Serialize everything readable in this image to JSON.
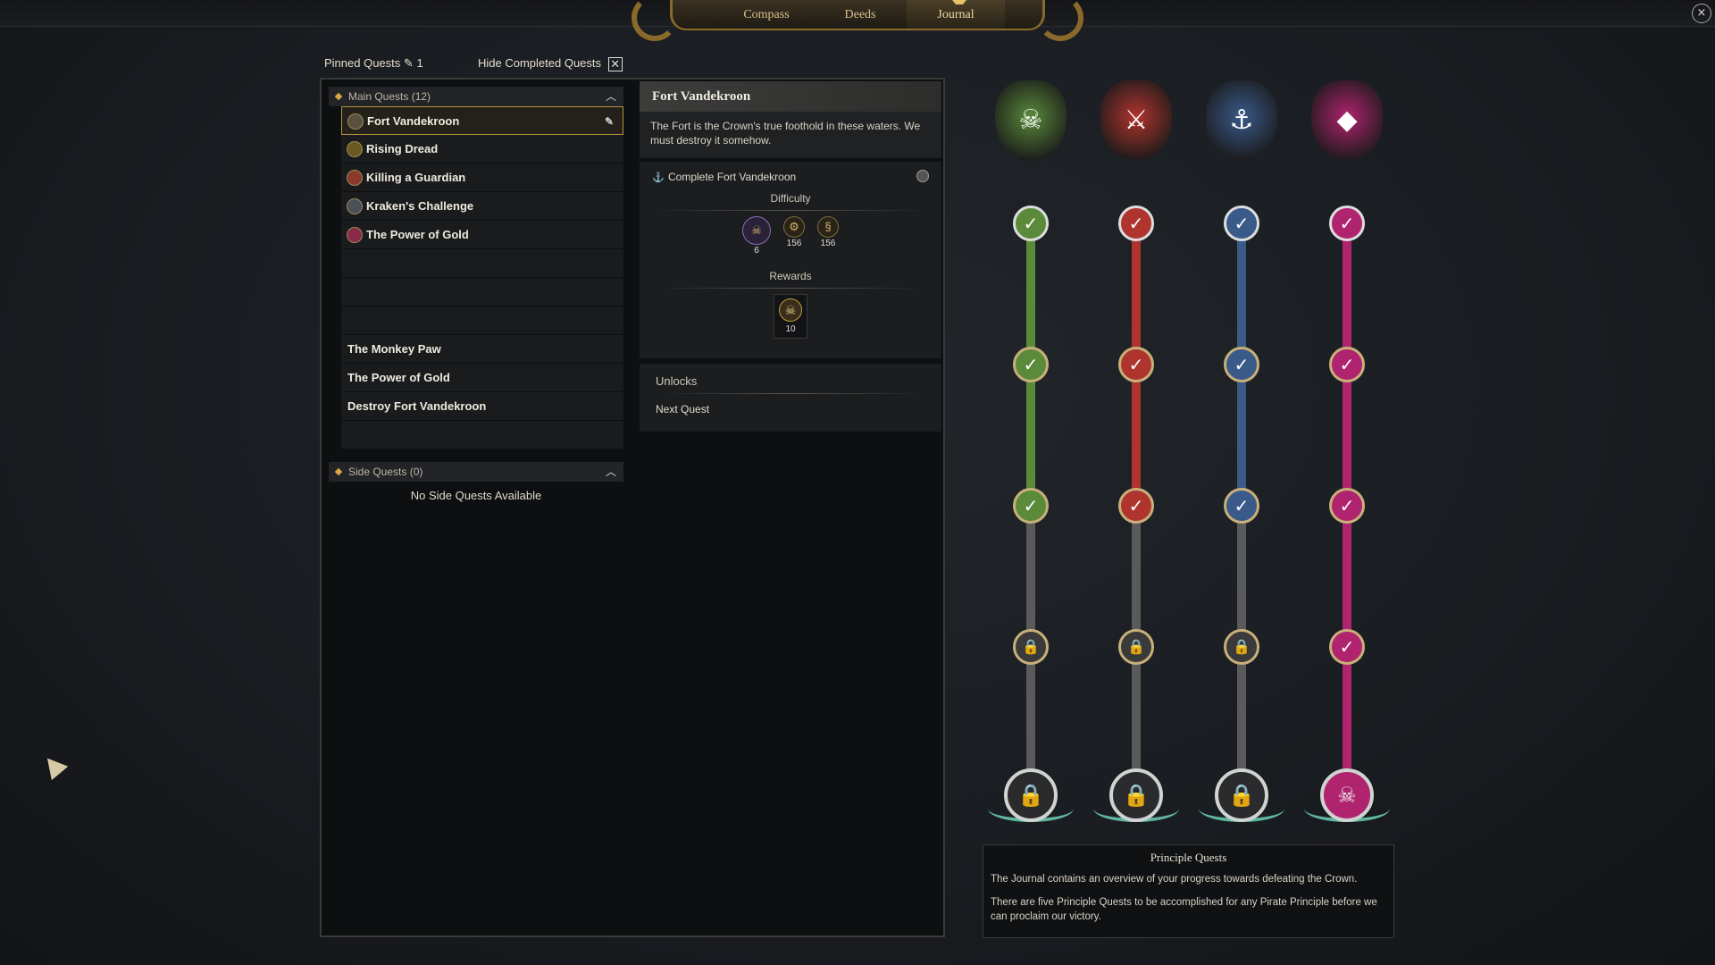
{
  "topbar": {
    "tabs": [
      {
        "label": "Compass"
      },
      {
        "label": "Deeds"
      },
      {
        "label": "Journal"
      }
    ],
    "close_icon": "×"
  },
  "filters": {
    "pinned_label": "Pinned Quests",
    "pinned_count": "1",
    "hide_completed_label": "Hide Completed Quests"
  },
  "main_quests": {
    "header": "Main Quests",
    "count": "(12)",
    "sub_items": [
      {
        "label": "Fort Vandekroon",
        "pinned": true
      },
      {
        "label": "Rising Dread"
      },
      {
        "label": "Killing a Guardian"
      },
      {
        "label": "Kraken's Challenge"
      },
      {
        "label": "The Power of Gold"
      }
    ],
    "plain_items": [
      {
        "label": "The Monkey Paw"
      },
      {
        "label": "The Power of Gold"
      },
      {
        "label": "Destroy Fort Vandekroon"
      }
    ]
  },
  "side_quests": {
    "header": "Side Quests",
    "count": "(0)",
    "empty_text": "No Side Quests Available"
  },
  "detail": {
    "title": "Fort Vandekroon",
    "description": "The Fort is the Crown's true foothold in these waters. We must destroy it somehow.",
    "objective": "Complete Fort Vandekroon",
    "difficulty_label": "Difficulty",
    "difficulty": [
      {
        "icon": "skull-crossbones-icon",
        "value": "6"
      },
      {
        "icon": "gear-icon",
        "value": "156"
      },
      {
        "icon": "scroll-icon",
        "value": "156"
      }
    ],
    "rewards_label": "Rewards",
    "reward": {
      "icon": "skull-medal-icon",
      "value": "10"
    },
    "unlocks_label": "Unlocks",
    "unlocks_value": "Next Quest"
  },
  "tracks": [
    {
      "name": "green",
      "color": "#5a8a3a",
      "crest_icon": "jolly-roger-icon",
      "completed_steps": 3
    },
    {
      "name": "red",
      "color": "#b0342e",
      "crest_icon": "crossed-swords-icon",
      "completed_steps": 3
    },
    {
      "name": "blue",
      "color": "#3a5a8a",
      "crest_icon": "anchor-icon",
      "completed_steps": 3
    },
    {
      "name": "magenta",
      "color": "#b0236e",
      "crest_icon": "gem-icon",
      "completed_steps": 4
    }
  ],
  "principle": {
    "title": "Principle Quests",
    "line1": "The Journal contains an overview of your progress towards defeating the Crown.",
    "line2": "There are five Principle Quests to be accomplished for any Pirate Principle before we can proclaim our victory."
  }
}
